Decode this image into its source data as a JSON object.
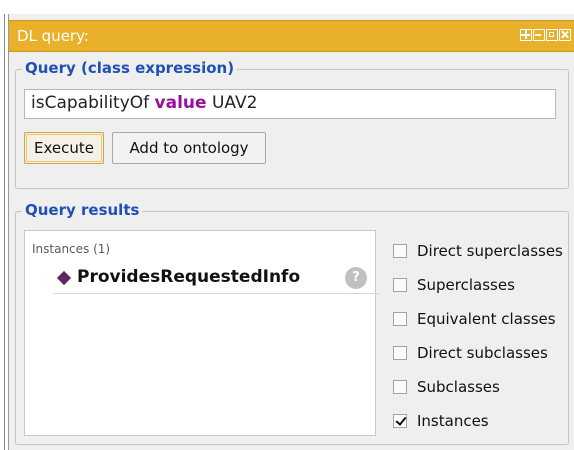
{
  "window": {
    "title": "DL query:"
  },
  "query": {
    "legend": "Query (class expression)",
    "expression_part1": "isCapabilityOf ",
    "expression_keyword": "value",
    "expression_part2": " UAV2",
    "execute_label": "Execute",
    "add_to_ontology_label": "Add to ontology"
  },
  "results": {
    "legend": "Query results",
    "section_header": "Instances (1)",
    "items": [
      {
        "name": "ProvidesRequestedInfo"
      }
    ],
    "help_symbol": "?",
    "options": [
      {
        "label": "Direct superclasses",
        "checked": false
      },
      {
        "label": "Superclasses",
        "checked": false
      },
      {
        "label": "Equivalent classes",
        "checked": false
      },
      {
        "label": "Direct subclasses",
        "checked": false
      },
      {
        "label": "Subclasses",
        "checked": false
      },
      {
        "label": "Instances",
        "checked": true
      }
    ]
  },
  "colors": {
    "title_bar": "#e9b02b",
    "legend_text": "#1f50b5",
    "keyword": "#9a0f9e",
    "individual_icon": "#5a2a5c"
  },
  "icons": {
    "window_controls": [
      "split-view-icon",
      "minimize-icon",
      "maximize-icon",
      "close-icon"
    ],
    "individual": "diamond-icon",
    "help": "help-icon"
  }
}
